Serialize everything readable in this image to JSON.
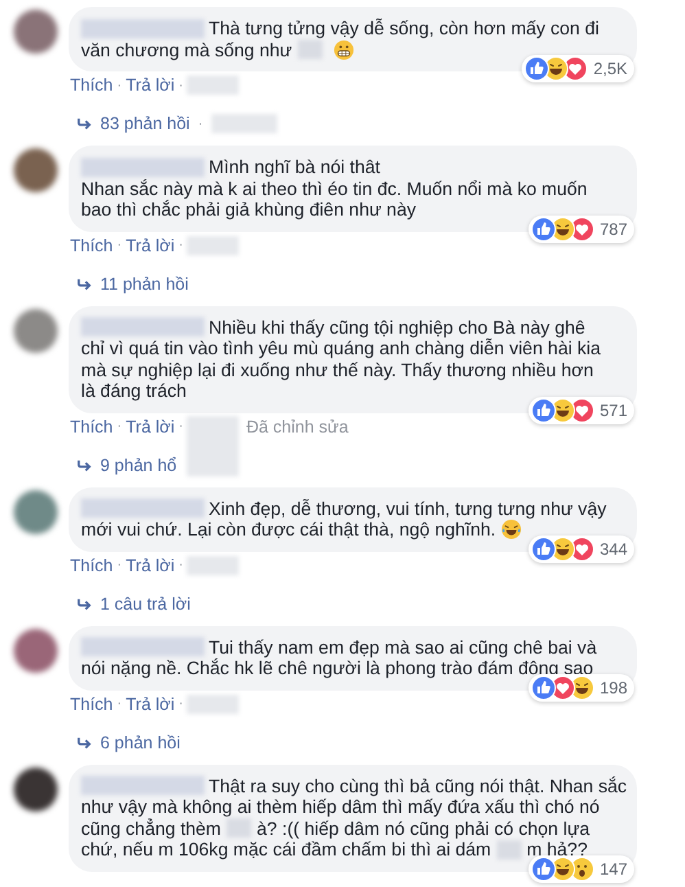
{
  "separator": "·",
  "comments": [
    {
      "avatar": {
        "color": "#8a7378"
      },
      "lines": [
        [
          {
            "kind": "text",
            "text": "Thà tưng tửng vậy dễ sống, còn hơn mấy con đi"
          }
        ],
        [
          {
            "kind": "text",
            "text": "văn chương mà sống như"
          },
          {
            "kind": "redacted"
          },
          {
            "kind": "grin"
          }
        ]
      ],
      "reactions": [
        {
          "kind": "like"
        },
        {
          "kind": "haha"
        },
        {
          "kind": "love"
        }
      ],
      "reaction_count": "2,5K",
      "actions": [
        "Thích",
        "Trả lời"
      ],
      "replies": {
        "text": "83 phản hồi",
        "kind": "dot"
      }
    },
    {
      "avatar": {
        "color": "#7a6250"
      },
      "lines": [
        [
          {
            "kind": "text",
            "text": "Mình nghĩ bà nói thât"
          }
        ],
        [
          {
            "kind": "text",
            "text": "Nhan sắc này mà k ai theo thì éo tin đc. Muốn nổi mà ko muốn"
          }
        ],
        [
          {
            "kind": "text",
            "text": "bao thì chắc phải giả khùng điên như này"
          }
        ]
      ],
      "reactions": [
        {
          "kind": "like"
        },
        {
          "kind": "haha"
        },
        {
          "kind": "love"
        }
      ],
      "reaction_count": "787",
      "actions": [
        "Thích",
        "Trả lời"
      ],
      "replies": {
        "text": "11 phản hồi",
        "kind": "none"
      }
    },
    {
      "avatar": {
        "color": "#8c8a88"
      },
      "lines": [
        [
          {
            "kind": "text",
            "text": "Nhiều khi thấy cũng tội nghiệp cho Bà này ghê"
          }
        ],
        [
          {
            "kind": "text",
            "text": "chỉ vì quá tin vào tình yêu mù quáng anh chàng diễn viên hài kia"
          }
        ],
        [
          {
            "kind": "text",
            "text": "mà sự nghiệp lại đi xuống như thế này. Thấy thương nhiều hơn"
          }
        ],
        [
          {
            "kind": "text",
            "text": "là đáng trách"
          }
        ]
      ],
      "reactions": [
        {
          "kind": "like"
        },
        {
          "kind": "haha"
        },
        {
          "kind": "love"
        }
      ],
      "reaction_count": "571",
      "actions": [
        "Thích",
        "Trả lời"
      ],
      "edited_note": "Đã chỉnh sửa",
      "replies": {
        "text": "9 phản hổ",
        "kind": "plain"
      }
    },
    {
      "avatar": {
        "color": "#6f8a88"
      },
      "lines": [
        [
          {
            "kind": "text",
            "text": "Xinh đẹp, dễ thương, vui tính, tưng tưng như vậy"
          }
        ],
        [
          {
            "kind": "text",
            "text": "mới vui chứ. Lại còn được cái thật thà, ngộ nghĩnh."
          },
          {
            "kind": "laugh"
          }
        ]
      ],
      "reactions": [
        {
          "kind": "like"
        },
        {
          "kind": "haha"
        },
        {
          "kind": "love"
        }
      ],
      "reaction_count": "344",
      "actions": [
        "Thích",
        "Trả lời"
      ],
      "replies": {
        "text": "1 câu trả lời",
        "kind": "none"
      }
    },
    {
      "avatar": {
        "color": "#9a6678"
      },
      "lines": [
        [
          {
            "kind": "text",
            "text": "Tui thấy nam em đẹp mà sao ai cũng chê bai và"
          }
        ],
        [
          {
            "kind": "text",
            "text": "nói nặng nề. Chắc hk lẽ chê người là phong trào đám đông sao"
          }
        ]
      ],
      "reactions": [
        {
          "kind": "like"
        },
        {
          "kind": "love"
        },
        {
          "kind": "haha"
        }
      ],
      "reaction_count": "198",
      "actions": [
        "Thích",
        "Trả lời"
      ],
      "replies": {
        "text": "6 phản hồi",
        "kind": "none"
      }
    },
    {
      "avatar": {
        "color": "#3a3434"
      },
      "lines": [
        [
          {
            "kind": "text",
            "text": "Thật ra suy cho cùng thì bả cũng nói thật. Nhan sắc"
          }
        ],
        [
          {
            "kind": "text",
            "text": "như vậy mà không ai thèm hiếp dâm thì mấy đứa xấu thì chó nó"
          }
        ],
        [
          {
            "kind": "text",
            "text": "cũng chẳng thèm"
          },
          {
            "kind": "redacted"
          },
          {
            "kind": "text",
            "text": "à? :(( hiếp dâm nó cũng phải có chọn lựa"
          }
        ],
        [
          {
            "kind": "text",
            "text": "chứ, nếu m 106kg mặc cái đầm chấm bi thì ai dám"
          },
          {
            "kind": "redacted"
          },
          {
            "kind": "text",
            "text": "m hả??"
          }
        ]
      ],
      "reactions": [
        {
          "kind": "like"
        },
        {
          "kind": "haha"
        },
        {
          "kind": "wow"
        }
      ],
      "reaction_count": "147"
    }
  ]
}
